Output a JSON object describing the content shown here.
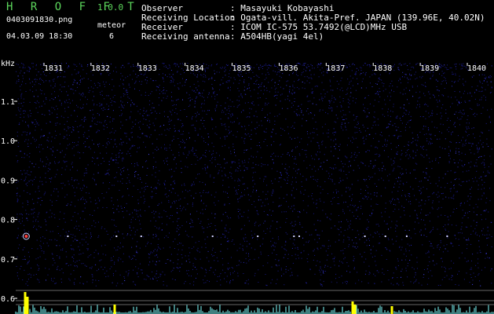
{
  "app": {
    "name": "H R O F F T",
    "version": "1.0.0"
  },
  "file": {
    "filename": "0403091830.png",
    "timestamp": "04.03.09 18:30",
    "meteor_label": "meteor",
    "meteor_count": "6"
  },
  "info": [
    {
      "label": "Observer",
      "value": ": Masayuki Kobayashi"
    },
    {
      "label": "Receiving Location",
      "value": ": Ogata-vill. Akita-Pref. JAPAN (139.96E, 40.02N)"
    },
    {
      "label": "Receiver",
      "value": ": ICOM IC-575 53.7492(@LCD)MHz USB"
    },
    {
      "label": "Receiving antenna",
      "value": ": A504HB(yagi 4el)"
    }
  ],
  "spectrogram": {
    "unit_label": "kHz",
    "time_ticks": [
      "1831",
      "1832",
      "1833",
      "1834",
      "1835",
      "1836",
      "1837",
      "1838",
      "1839",
      "1840"
    ],
    "freq_ticks": [
      "1.1",
      "1.0",
      "0.9",
      "0.8",
      "0.7",
      "0.6"
    ],
    "colors": {
      "background": "#000000",
      "noise": "#1a1a8c",
      "echo": "#d0d0ff",
      "meteor_head": "#ff4040",
      "level_line": "#7fffff",
      "level_peak": "#ffff00",
      "text": "#ffffff"
    }
  }
}
